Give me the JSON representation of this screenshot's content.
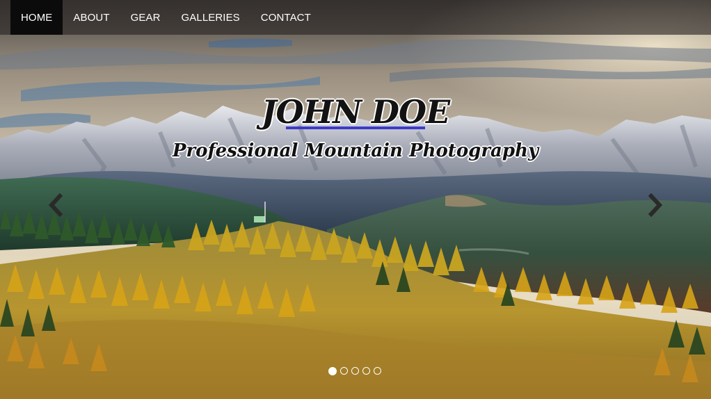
{
  "nav": {
    "items": [
      {
        "label": "HOME",
        "active": true
      },
      {
        "label": "ABOUT",
        "active": false
      },
      {
        "label": "GEAR",
        "active": false
      },
      {
        "label": "GALLERIES",
        "active": false
      },
      {
        "label": "CONTACT",
        "active": false
      }
    ]
  },
  "hero": {
    "title": "JOHN DOE",
    "subtitle": "Professional Mountain Photography",
    "accent_color": "#3d3ac9"
  },
  "carousel": {
    "icons": {
      "prev": "chevron-left-icon",
      "next": "chevron-right-icon"
    },
    "slide_count": 5,
    "active_slide": 1
  }
}
